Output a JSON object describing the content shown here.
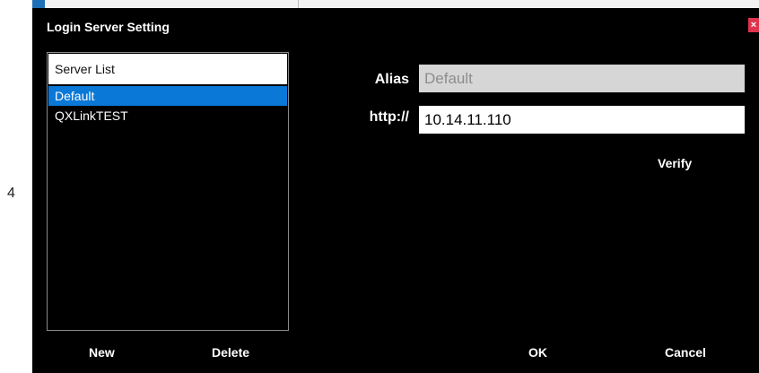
{
  "side": {
    "number": "4"
  },
  "dialog": {
    "title": "Login Server Setting",
    "close_label": "×"
  },
  "server_list": {
    "header": "Server List",
    "items": [
      {
        "label": "Default",
        "selected": true
      },
      {
        "label": "QXLinkTEST",
        "selected": false
      }
    ]
  },
  "form": {
    "alias_label": "Alias",
    "alias_value": "Default",
    "url_label": "http://",
    "url_value": "10.14.11.110",
    "verify_label": "Verify"
  },
  "footer": {
    "new_label": "New",
    "delete_label": "Delete",
    "ok_label": "OK",
    "cancel_label": "Cancel"
  },
  "colors": {
    "dialog_background": "#000000",
    "selection": "#0a78d7",
    "close_button": "#e0334e"
  }
}
